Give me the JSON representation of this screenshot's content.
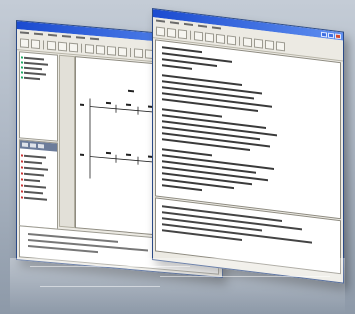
{
  "windows": [
    {
      "id": "diagram-editor",
      "title": ""
    },
    {
      "id": "text-editor",
      "title": ""
    }
  ],
  "diagram": {
    "highlight_color": "#e86a7a",
    "line_color": "#222222"
  }
}
